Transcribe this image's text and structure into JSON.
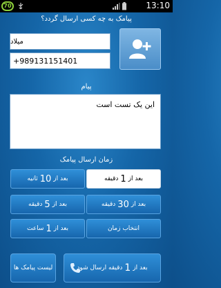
{
  "status_bar": {
    "battery_level": "70",
    "clock": "13:10"
  },
  "header": {
    "title": "پیامک به چه کسی ارسال گردد؟"
  },
  "contact": {
    "name_value": "میلاد",
    "phone_value": "+989131151401",
    "add_contact_icon": "add-contact-icon"
  },
  "message": {
    "label": "پیام",
    "text": "این یک تست است"
  },
  "schedule": {
    "label": "زمان ارسال پیامک",
    "options": [
      {
        "prefix": "بعد از",
        "num": "1",
        "unit": "دقیقه"
      },
      {
        "prefix": "بعد از",
        "num": "10",
        "unit": "ثانیه"
      },
      {
        "prefix": "بعد از",
        "num": "30",
        "unit": "دقیقه"
      },
      {
        "prefix": "بعد از",
        "num": "5",
        "unit": "دقیقه"
      },
      {
        "prefix": "",
        "num": "",
        "unit": "انتخاب زمان"
      },
      {
        "prefix": "بعد از",
        "num": "1",
        "unit": "ساعت"
      }
    ],
    "selected_index": 0
  },
  "actions": {
    "send_prefix": "بعد از",
    "send_num": "1",
    "send_suffix": "دقیقه ارسال شود",
    "list_label": "لیست پیامک ها",
    "send_icon": "phone-icon"
  },
  "colors": {
    "background": "#1566a8",
    "button": "#1f78c2",
    "battery": "#8fd13b"
  }
}
